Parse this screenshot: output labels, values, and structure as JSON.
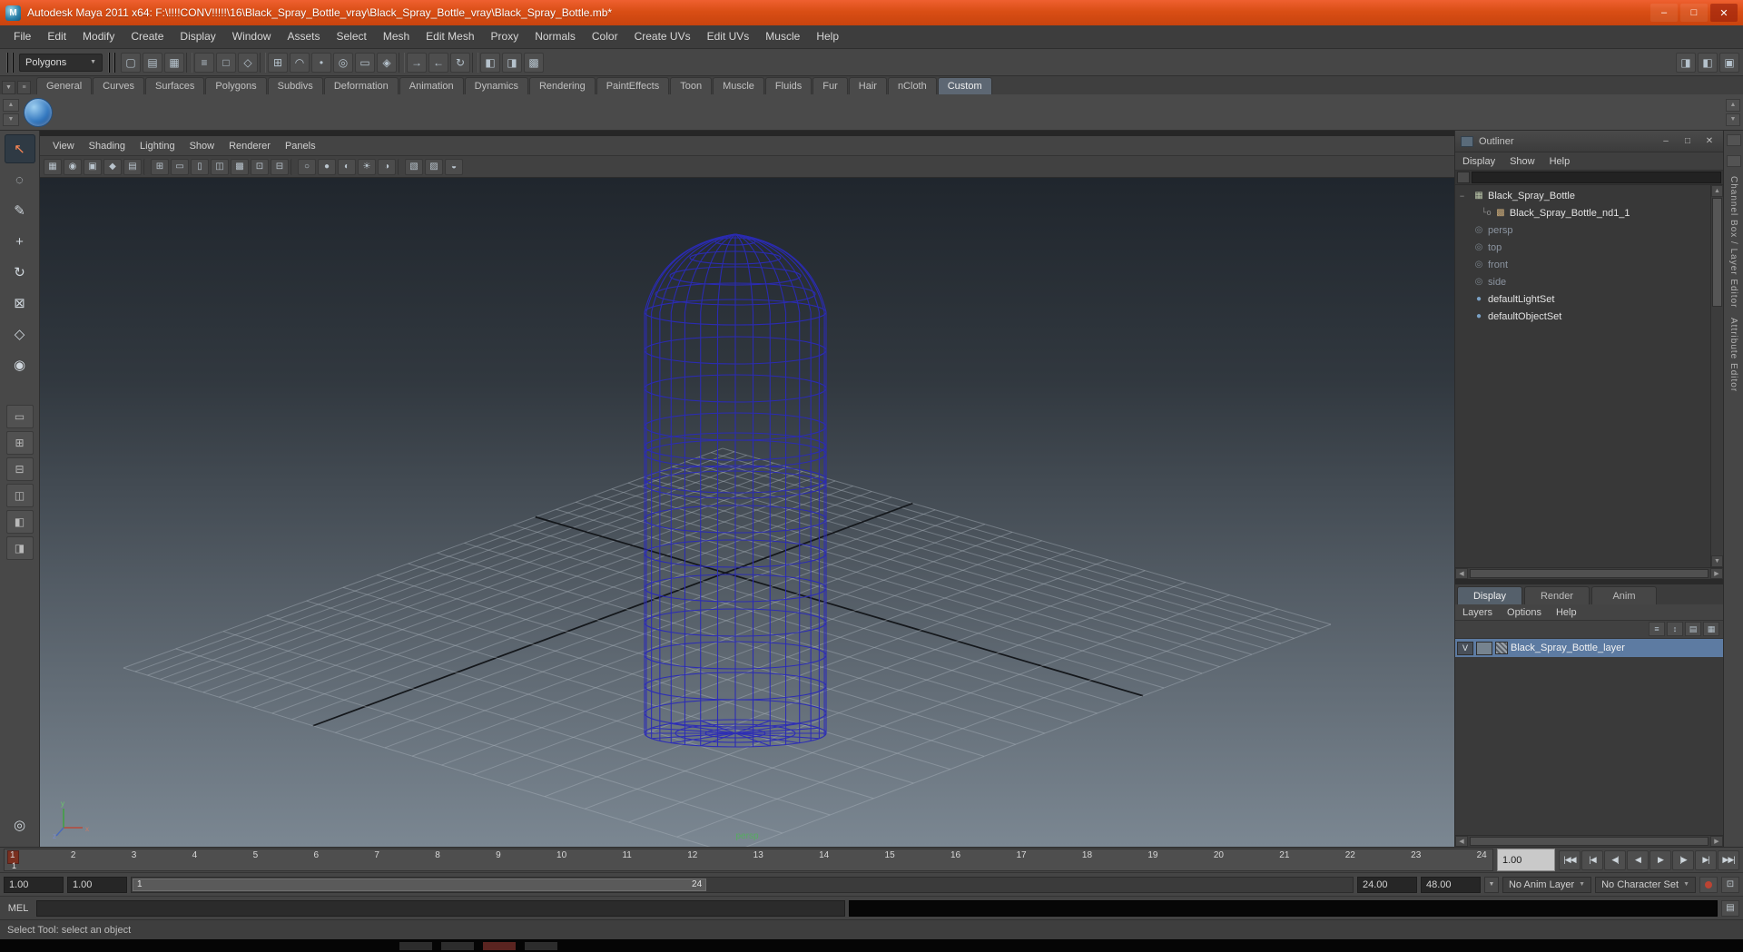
{
  "window": {
    "title": "Autodesk Maya 2011 x64: F:\\!!!!CONV!!!!!\\16\\Black_Spray_Bottle_vray\\Black_Spray_Bottle_vray\\Black_Spray_Bottle.mb*",
    "app_initial": "M"
  },
  "glyphs": {
    "minimize": "–",
    "maximize": "□",
    "close": "✕",
    "up": "▲",
    "down": "▼",
    "left": "◀",
    "right": "▶",
    "dropdown": "▼",
    "collapse": "−"
  },
  "menu_bar": {
    "items": [
      "File",
      "Edit",
      "Modify",
      "Create",
      "Display",
      "Window",
      "Assets",
      "Select",
      "Mesh",
      "Edit Mesh",
      "Proxy",
      "Normals",
      "Color",
      "Create UVs",
      "Edit UVs",
      "Muscle",
      "Help"
    ]
  },
  "status_line": {
    "menu_set": "Polygons",
    "icons": [
      {
        "name": "new-scene-icon",
        "glyph": "▢"
      },
      {
        "name": "open-scene-icon",
        "glyph": "▤"
      },
      {
        "name": "save-scene-icon",
        "glyph": "▦"
      },
      {
        "sep": true
      },
      {
        "name": "select-by-hierarchy-icon",
        "glyph": "≡"
      },
      {
        "name": "select-by-object-icon",
        "glyph": "□"
      },
      {
        "name": "select-by-component-icon",
        "glyph": "◇"
      },
      {
        "sep": true
      },
      {
        "name": "snap-to-grids-icon",
        "glyph": "⊞"
      },
      {
        "name": "snap-to-curves-icon",
        "glyph": "◠"
      },
      {
        "name": "snap-to-points-icon",
        "glyph": "•"
      },
      {
        "name": "snap-to-projected-center-icon",
        "glyph": "◎"
      },
      {
        "name": "snap-to-view-planes-icon",
        "glyph": "▭"
      },
      {
        "name": "make-live-icon",
        "glyph": "◈"
      },
      {
        "sep": true
      },
      {
        "name": "input-connections-icon",
        "glyph": "→"
      },
      {
        "name": "output-connections-icon",
        "glyph": "←"
      },
      {
        "name": "construction-history-icon",
        "glyph": "↻"
      },
      {
        "sep": true
      },
      {
        "name": "render-current-frame-icon",
        "glyph": "◧"
      },
      {
        "name": "ipr-render-icon",
        "glyph": "◨"
      },
      {
        "name": "render-settings-icon",
        "glyph": "▩"
      }
    ],
    "right_icons": [
      {
        "name": "toggle-attribute-editor-icon",
        "glyph": "◨"
      },
      {
        "name": "toggle-tool-settings-icon",
        "glyph": "◧"
      },
      {
        "name": "toggle-channel-box-icon",
        "glyph": "▣"
      }
    ]
  },
  "shelf": {
    "tabs": [
      {
        "label": "General",
        "active": false
      },
      {
        "label": "Curves",
        "active": false
      },
      {
        "label": "Surfaces",
        "active": false
      },
      {
        "label": "Polygons",
        "active": false
      },
      {
        "label": "Subdivs",
        "active": false
      },
      {
        "label": "Deformation",
        "active": false
      },
      {
        "label": "Animation",
        "active": false
      },
      {
        "label": "Dynamics",
        "active": false
      },
      {
        "label": "Rendering",
        "active": false
      },
      {
        "label": "PaintEffects",
        "active": false
      },
      {
        "label": "Toon",
        "active": false
      },
      {
        "label": "Muscle",
        "active": false
      },
      {
        "label": "Fluids",
        "active": false
      },
      {
        "label": "Fur",
        "active": false
      },
      {
        "label": "Hair",
        "active": false
      },
      {
        "label": "nCloth",
        "active": false
      },
      {
        "label": "Custom",
        "active": true
      }
    ]
  },
  "toolbox": {
    "tools": [
      {
        "name": "select-tool",
        "glyph": "↖",
        "active": true
      },
      {
        "name": "lasso-select-tool",
        "glyph": "◌",
        "active": false
      },
      {
        "name": "paint-selection-tool",
        "glyph": "✎",
        "active": false
      },
      {
        "name": "move-tool",
        "glyph": "+",
        "active": false
      },
      {
        "name": "rotate-tool",
        "glyph": "↻",
        "active": false
      },
      {
        "name": "scale-tool",
        "glyph": "⊠",
        "active": false
      },
      {
        "name": "universal-manipulator-tool",
        "glyph": "◇",
        "active": false
      },
      {
        "name": "soft-modification-tool",
        "glyph": "◉",
        "active": false
      }
    ],
    "layouts": [
      {
        "name": "layout-single-pane-button",
        "glyph": "▭"
      },
      {
        "name": "layout-four-pane-button",
        "glyph": "⊞"
      },
      {
        "name": "layout-two-pane-stacked-button",
        "glyph": "⊟"
      },
      {
        "name": "layout-two-pane-side-button",
        "glyph": "◫"
      },
      {
        "name": "layout-persp-outliner-button",
        "glyph": "◧"
      },
      {
        "name": "layout-persp-graph-button",
        "glyph": "◨"
      }
    ],
    "bottom_glyph": "◎"
  },
  "viewport": {
    "menus": [
      "View",
      "Shading",
      "Lighting",
      "Show",
      "Renderer",
      "Panels"
    ],
    "toolbar_icons": [
      {
        "name": "select-camera-icon",
        "glyph": "▦"
      },
      {
        "name": "lock-camera-icon",
        "glyph": "◉"
      },
      {
        "name": "camera-attributes-icon",
        "glyph": "▣"
      },
      {
        "name": "bookmark-view-icon",
        "glyph": "◆"
      },
      {
        "name": "image-plane-icon",
        "glyph": "▤"
      },
      {
        "sep": true
      },
      {
        "name": "grid-display-icon",
        "glyph": "⊞"
      },
      {
        "name": "film-gate-icon",
        "glyph": "▭"
      },
      {
        "name": "resolution-gate-icon",
        "glyph": "▯"
      },
      {
        "name": "gate-mask-icon",
        "glyph": "◫"
      },
      {
        "name": "field-chart-icon",
        "glyph": "▩"
      },
      {
        "name": "safe-action-icon",
        "glyph": "⊡"
      },
      {
        "name": "safe-title-icon",
        "glyph": "⊟"
      },
      {
        "sep": true
      },
      {
        "name": "wireframe-display-icon",
        "glyph": "○"
      },
      {
        "name": "smooth-shade-display-icon",
        "glyph": "●"
      },
      {
        "name": "textured-display-icon",
        "glyph": "◐"
      },
      {
        "name": "use-all-lights-icon",
        "glyph": "☀"
      },
      {
        "name": "shadows-display-icon",
        "glyph": "◑"
      },
      {
        "sep": true
      },
      {
        "name": "isolate-select-icon",
        "glyph": "▧"
      },
      {
        "name": "xray-display-icon",
        "glyph": "▨"
      },
      {
        "name": "wireframe-on-shaded-icon",
        "glyph": "◒"
      }
    ],
    "camera_label": "persp",
    "axis_gizmo": {
      "x": "x",
      "y": "y",
      "z": "z"
    }
  },
  "scene": {
    "wireframe_color": "#2b2bb8",
    "grid_minor_color": "rgba(168,177,187,0.45)",
    "grid_major_color": "#14171b",
    "grid_divisions": 24
  },
  "outliner": {
    "title": "Outliner",
    "menus": [
      "Display",
      "Show",
      "Help"
    ],
    "items": [
      {
        "gutter": "−",
        "prefix": "",
        "pad": "",
        "icon": "▦",
        "icon_class": "icon-transform",
        "icon_name": "transform-node-icon",
        "label": "Black_Spray_Bottle",
        "dimmed": false
      },
      {
        "gutter": "",
        "prefix": "└o",
        "pad": "pad1",
        "icon": "▩",
        "icon_class": "icon-shape",
        "icon_name": "shape-node-icon",
        "label": "Black_Spray_Bottle_nd1_1",
        "dimmed": false
      },
      {
        "gutter": "",
        "prefix": "",
        "pad": "",
        "icon": "◎",
        "icon_class": "icon-camera",
        "icon_name": "camera-icon",
        "label": "persp",
        "dimmed": true
      },
      {
        "gutter": "",
        "prefix": "",
        "pad": "",
        "icon": "◎",
        "icon_class": "icon-camera",
        "icon_name": "camera-icon",
        "label": "top",
        "dimmed": true
      },
      {
        "gutter": "",
        "prefix": "",
        "pad": "",
        "icon": "◎",
        "icon_class": "icon-camera",
        "icon_name": "camera-icon",
        "label": "front",
        "dimmed": true
      },
      {
        "gutter": "",
        "prefix": "",
        "pad": "",
        "icon": "◎",
        "icon_class": "icon-camera",
        "icon_name": "camera-icon",
        "label": "side",
        "dimmed": true
      },
      {
        "gutter": "",
        "prefix": "",
        "pad": "",
        "icon": "●",
        "icon_class": "icon-set",
        "icon_name": "set-icon",
        "label": "defaultLightSet",
        "dimmed": false
      },
      {
        "gutter": "",
        "prefix": "",
        "pad": "",
        "icon": "●",
        "icon_class": "icon-set",
        "icon_name": "set-icon",
        "label": "defaultObjectSet",
        "dimmed": false
      }
    ]
  },
  "layer_editor": {
    "tabs": [
      {
        "label": "Display",
        "active": true
      },
      {
        "label": "Render",
        "active": false
      },
      {
        "label": "Anim",
        "active": false
      }
    ],
    "menus": [
      "Layers",
      "Options",
      "Help"
    ],
    "toolbar_icons": [
      {
        "name": "layer-options-icon",
        "glyph": "≡"
      },
      {
        "name": "move-layer-icon",
        "glyph": "↕"
      },
      {
        "name": "create-empty-layer-icon",
        "glyph": "▤"
      },
      {
        "name": "create-layer-from-selected-icon",
        "glyph": "▦"
      }
    ],
    "layers": [
      {
        "visibility": "V",
        "name": "Black_Spray_Bottle_layer",
        "selected": true
      }
    ]
  },
  "side_tabs": {
    "channel_box": "Channel Box / Layer Editor",
    "attribute_editor": "Attribute Editor"
  },
  "time_slider": {
    "frames": [
      "1",
      "2",
      "3",
      "4",
      "5",
      "6",
      "7",
      "8",
      "9",
      "10",
      "11",
      "12",
      "13",
      "14",
      "15",
      "16",
      "17",
      "18",
      "19",
      "20",
      "21",
      "22",
      "23",
      "24"
    ],
    "current_frame": "1",
    "current_time": "1.00",
    "playback_buttons": [
      {
        "name": "go-to-start-button",
        "glyph": "|◀◀"
      },
      {
        "name": "step-back-frame-button",
        "glyph": "|◀"
      },
      {
        "name": "step-back-key-button",
        "glyph": "◀|"
      },
      {
        "name": "play-backwards-button",
        "glyph": "◀"
      },
      {
        "name": "play-forwards-button",
        "glyph": "▶"
      },
      {
        "name": "step-forward-key-button",
        "glyph": "|▶"
      },
      {
        "name": "step-forward-frame-button",
        "glyph": "▶|"
      },
      {
        "name": "go-to-end-button",
        "glyph": "▶▶|"
      }
    ]
  },
  "range_slider": {
    "animation_start": "1.00",
    "playback_start": "1.00",
    "range_start_label": "1",
    "range_end_label": "24",
    "playback_end": "24.00",
    "animation_end": "48.00",
    "anim_layer": "No Anim Layer",
    "character_set": "No Character Set"
  },
  "command_line": {
    "label": "MEL"
  },
  "help_line": {
    "text": "Select Tool: select an object"
  }
}
